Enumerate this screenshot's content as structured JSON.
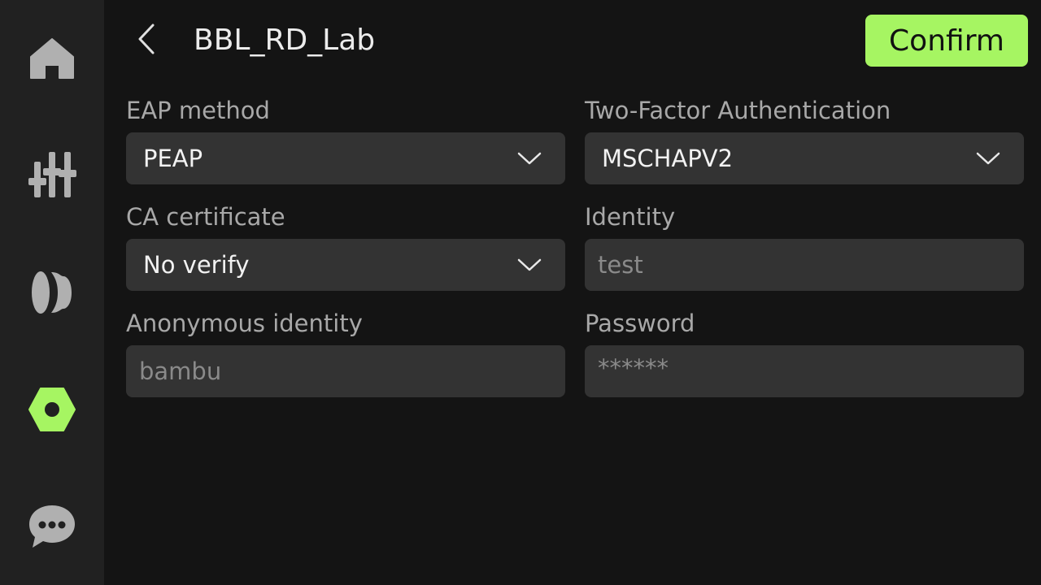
{
  "sidebar": {
    "items": [
      {
        "name": "home",
        "icon": "home-icon",
        "active": false
      },
      {
        "name": "controls",
        "icon": "sliders-icon",
        "active": false
      },
      {
        "name": "filament",
        "icon": "filament-spool-icon",
        "active": false
      },
      {
        "name": "settings",
        "icon": "hex-nut-settings-icon",
        "active": true
      },
      {
        "name": "messages",
        "icon": "chat-bubble-icon",
        "active": false
      }
    ]
  },
  "header": {
    "title": "BBL_RD_Lab",
    "confirm_label": "Confirm",
    "back_icon": "chevron-left-icon"
  },
  "form": {
    "eap_method": {
      "label": "EAP method",
      "value": "PEAP"
    },
    "two_factor": {
      "label": "Two-Factor Authentication",
      "value": "MSCHAPV2"
    },
    "ca_certificate": {
      "label": "CA certificate",
      "value": "No verify"
    },
    "identity": {
      "label": "Identity",
      "placeholder": "test"
    },
    "anonymous_identity": {
      "label": "Anonymous identity",
      "placeholder": "bambu"
    },
    "password": {
      "label": "Password",
      "placeholder": "******"
    }
  },
  "colors": {
    "accent": "#a6f562",
    "background": "#141414",
    "sidebar": "#212121",
    "field": "#333333",
    "icon_inactive": "#b0b0b0"
  }
}
